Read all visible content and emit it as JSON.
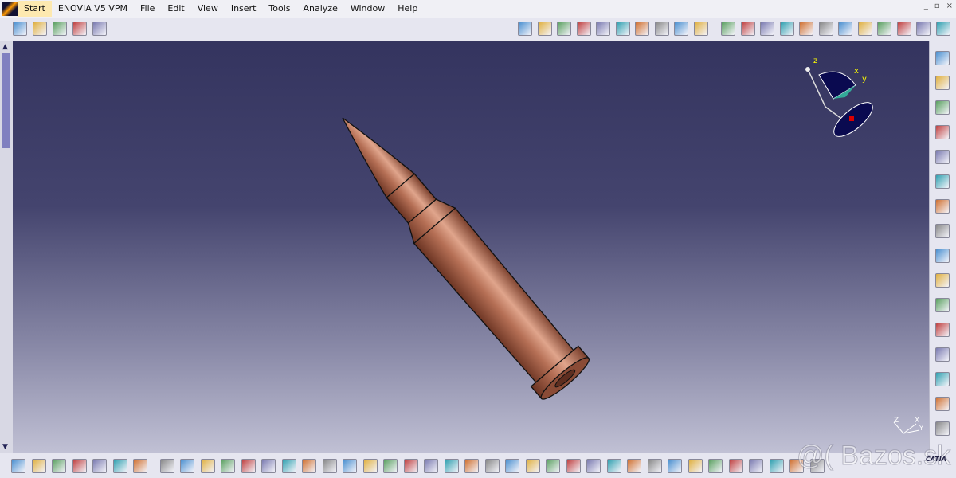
{
  "menubar": {
    "items": [
      "Start",
      "ENOVIA V5 VPM",
      "File",
      "Edit",
      "View",
      "Insert",
      "Tools",
      "Analyze",
      "Window",
      "Help"
    ],
    "window_controls": [
      "_",
      "▫",
      "×"
    ]
  },
  "top_toolbar": {
    "left_icons": [
      "catalog-icon",
      "properties-icon",
      "image-icon",
      "macro-icon",
      "help-icon"
    ],
    "right_icons": [
      "sketch-icon",
      "part-body-icon",
      "constraint-icon",
      "plane-icon",
      "pad-icon",
      "pocket-icon",
      "shaft-icon",
      "groove-icon",
      "hole-icon",
      "rib-icon",
      "fillet-icon",
      "chamfer-icon",
      "draft-icon",
      "shell-icon",
      "thickness-icon",
      "thread-icon",
      "mirror-icon",
      "pattern-icon",
      "scaling-icon",
      "boolean-icon",
      "annotation-icon",
      "measure-icon"
    ]
  },
  "right_toolbar": {
    "icons": [
      "constraint-icon",
      "boolean-add-icon",
      "boolean-remove-icon",
      "select-icon",
      "sketcher-icon",
      "surface-icon",
      "transform-icon",
      "apply-material-icon",
      "analysis-icon",
      "draft-analysis-icon",
      "curvature-icon",
      "axis-system-icon",
      "publication-icon",
      "spec-tree-icon",
      "update-icon",
      "measure-icon"
    ]
  },
  "bottom_toolbar": {
    "icons": [
      "update-all-icon",
      "swap-icon",
      "eraser-icon",
      "catalog-icon",
      "materials-icon",
      "compass-icon",
      "grid-icon",
      "new-icon",
      "open-icon",
      "save-icon",
      "print-icon",
      "cut-icon",
      "copy-icon",
      "paste-icon",
      "undo-icon",
      "redo-icon",
      "whats-this-icon",
      "formula-icon",
      "comment-icon",
      "law-icon",
      "table-icon",
      "tree-icon",
      "lock-icon",
      "parameters-icon",
      "fly-icon",
      "fit-all-icon",
      "pan-icon",
      "rotate-icon",
      "zoom-in-icon",
      "zoom-out-icon",
      "normal-view-icon",
      "multi-view-icon",
      "iso-view-icon",
      "hide-show-icon",
      "swap-visible-icon",
      "shading-icon",
      "capture-icon",
      "measure-between-icon",
      "measure-item-icon",
      "mass-icon"
    ]
  },
  "compass": {
    "labels": {
      "x": "x",
      "y": "y",
      "z": "z"
    }
  },
  "axis_triad": {
    "labels": {
      "x": "X",
      "y": "Y",
      "z": "Z"
    }
  },
  "watermark": "@( Bazos.sk",
  "brand": "CATIA",
  "colors": {
    "bullet": "#b06a50",
    "background_top": "#34345f",
    "background_bottom": "#c0c0d4"
  }
}
